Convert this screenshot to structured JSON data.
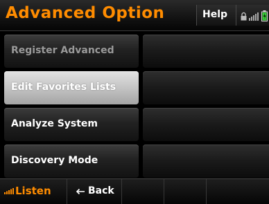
{
  "header": {
    "title": "Advanced Option",
    "help_label": "Help",
    "status_icons": [
      "lock-icon",
      "signal-icon",
      "battery-icon"
    ]
  },
  "menu": {
    "items": [
      {
        "label": "Register Advanced",
        "state": "disabled"
      },
      {
        "label": "Edit Favorites Lists",
        "state": "selected"
      },
      {
        "label": "Analyze System",
        "state": "normal"
      },
      {
        "label": "Discovery Mode",
        "state": "normal"
      }
    ]
  },
  "footer": {
    "listen_label": "Listen",
    "back_label": "Back",
    "listen_icon": "signal-icon",
    "back_icon": "back-arrow-icon"
  },
  "colors": {
    "accent": "#ff8c00",
    "background": "#000000",
    "selected_button": "#c4c4c4",
    "disabled_text": "#9a9a9a"
  }
}
